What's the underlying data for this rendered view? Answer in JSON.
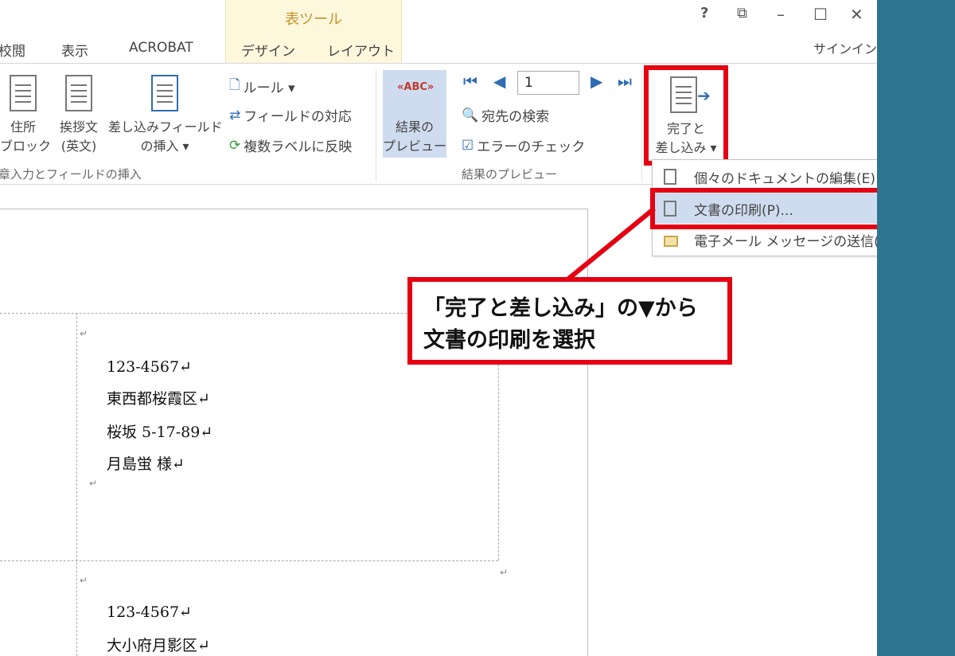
{
  "ribbon": {
    "tools_title": "表ツール",
    "tabs": [
      "校閲",
      "表示",
      "ACROBAT",
      "デザイン",
      "レイアウト"
    ],
    "window_controls": [
      "?",
      "⧉",
      "–",
      "☐",
      "✕"
    ],
    "signin": "サインイン",
    "buttons": {
      "address_block": [
        "住所",
        "ブロック"
      ],
      "greeting": [
        "挨拶文",
        "(英文)"
      ],
      "merge_field": [
        "差し込みフィールド",
        "の挿入 ▾"
      ],
      "rules": "ルール ▾",
      "match_fields": "フィールドの対応",
      "update_labels": "複数ラベルに反映",
      "preview": [
        "結果の",
        "プレビュー"
      ],
      "record_number": "1",
      "find_recipient": "宛先の検索",
      "check_errors": "エラーのチェック",
      "finish_merge": [
        "完了と",
        "差し込み ▾"
      ]
    },
    "groups": {
      "write_insert": "章入力とフィールドの挿入",
      "preview_results": "結果のプレビュー"
    }
  },
  "menu": {
    "items": [
      {
        "label": "個々のドキュメントの編集(E)..."
      },
      {
        "label": "文書の印刷(P)..."
      },
      {
        "label": "電子メール メッセージの送信(S)..."
      }
    ]
  },
  "document": {
    "labels": [
      {
        "postal": "123-4567↵",
        "city": "東西都桜霞区↵",
        "street": "桜坂 5-17-89↵",
        "name": "月島蛍 様↵"
      },
      {
        "postal": "123-4567↵",
        "city": "大小府月影区↵"
      }
    ],
    "return_mark": "↵"
  },
  "callout": {
    "line1": "「完了と差し込み」の▼から",
    "line2": "文書の印刷を選択"
  },
  "colors": {
    "highlight_red": "#e50012",
    "side_panel": "#2b7592",
    "tools_band": "#fdf7dc",
    "selected_blue": "#cfdcef"
  }
}
